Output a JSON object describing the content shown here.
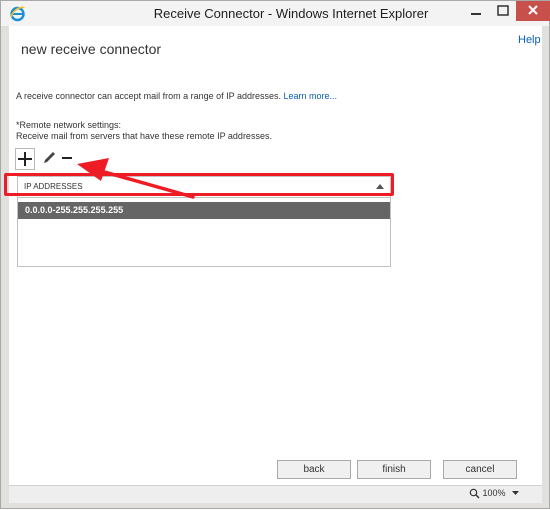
{
  "window": {
    "title": "Receive Connector - Windows Internet Explorer",
    "icons": {
      "app": "ie-logo-icon",
      "minimize": "minimize-icon",
      "maximize": "maximize-icon",
      "close": "close-icon"
    },
    "close_color": "#c7504b"
  },
  "page": {
    "title": "new receive connector",
    "help_label": "Help",
    "description": "A receive connector can accept mail from a range of IP addresses.",
    "learn_more_label": "Learn more...",
    "section_label": "*Remote network settings:",
    "section_sublabel": "Receive mail from servers that have these remote IP addresses."
  },
  "toolbar": {
    "icons": [
      "add-icon",
      "edit-icon",
      "remove-icon"
    ]
  },
  "ip_table": {
    "column_header": "IP ADDRESSES",
    "rows": [
      "0.0.0.0-255.255.255.255"
    ],
    "selected_row_color": "#656565"
  },
  "annotation": {
    "highlight_color": "#ee1c25",
    "arrow_color": "#ee1c25"
  },
  "footer": {
    "back_label": "back",
    "finish_label": "finish",
    "cancel_label": "cancel"
  },
  "statusbar": {
    "zoom": "100%"
  },
  "colors": {
    "link": "#0a5fb4",
    "frame": "#e2e0dc"
  }
}
